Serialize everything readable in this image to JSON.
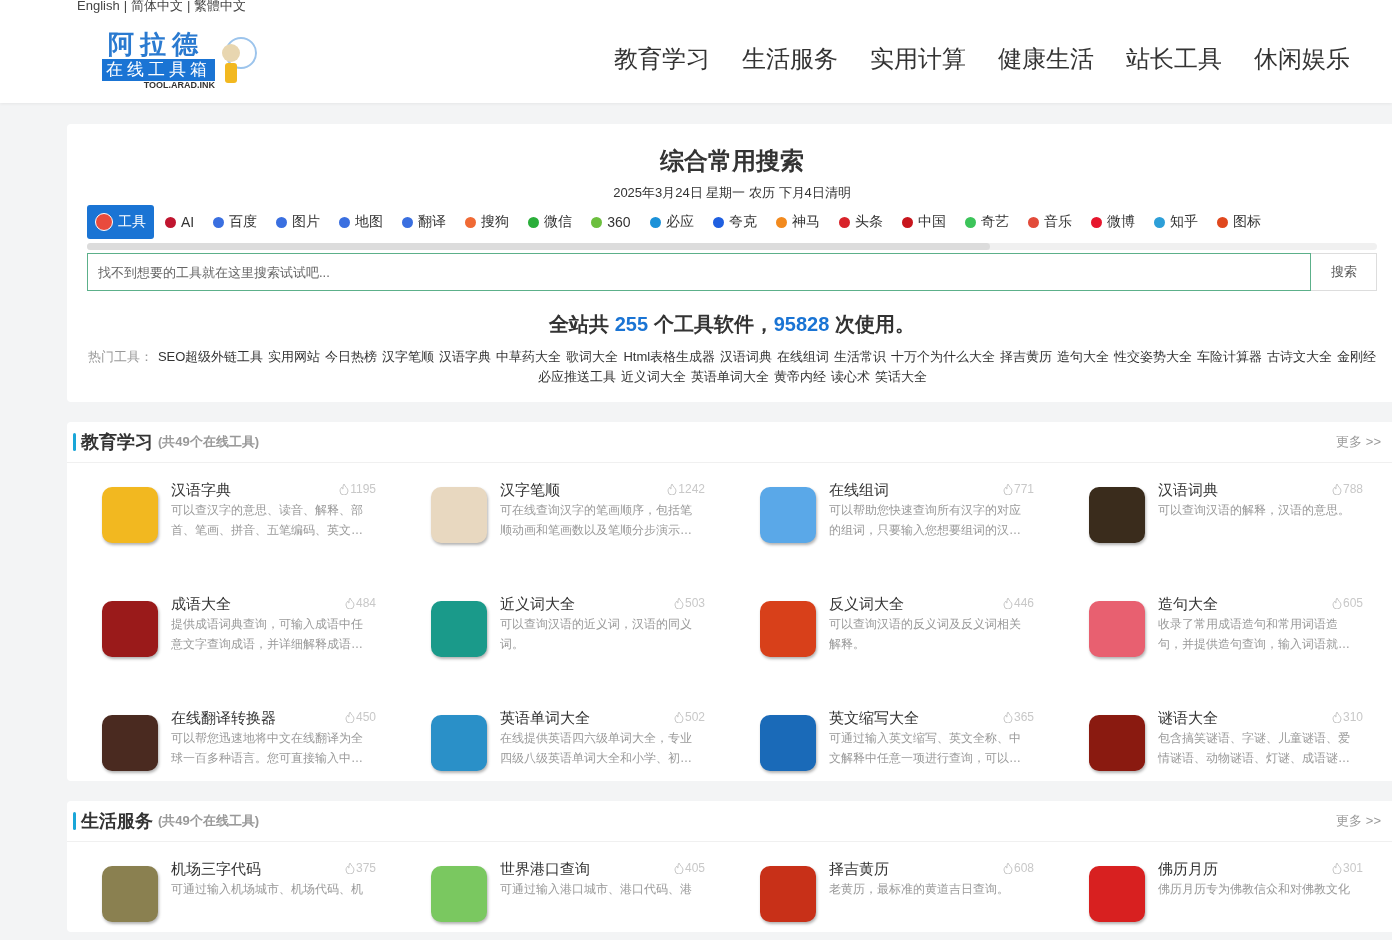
{
  "languages": [
    "English",
    "简体中文",
    "繁體中文"
  ],
  "language_separator": "|",
  "logo": {
    "title": "阿拉德",
    "subtitle": "在线工具箱",
    "domain": "TOOL.ARAD.INK"
  },
  "nav": [
    "教育学习",
    "生活服务",
    "实用计算",
    "健康生活",
    "站长工具",
    "休闲娱乐"
  ],
  "search": {
    "title": "综合常用搜索",
    "date": "2025年3月24日 星期一 农历 下月4日清明",
    "engines": [
      {
        "label": "工具",
        "selected": true,
        "color": "#e94b3c"
      },
      {
        "label": "AI",
        "selected": false,
        "color": "#c0152f"
      },
      {
        "label": "百度",
        "selected": false,
        "color": "#3a6fe0"
      },
      {
        "label": "图片",
        "selected": false,
        "color": "#3a6fe0"
      },
      {
        "label": "地图",
        "selected": false,
        "color": "#3a6fe0"
      },
      {
        "label": "翻译",
        "selected": false,
        "color": "#3a6fe0"
      },
      {
        "label": "搜狗",
        "selected": false,
        "color": "#f06a35"
      },
      {
        "label": "微信",
        "selected": false,
        "color": "#2aae3a"
      },
      {
        "label": "360",
        "selected": false,
        "color": "#6cbf3e"
      },
      {
        "label": "必应",
        "selected": false,
        "color": "#1b91d8"
      },
      {
        "label": "夸克",
        "selected": false,
        "color": "#1f5fe0"
      },
      {
        "label": "神马",
        "selected": false,
        "color": "#f28a1e"
      },
      {
        "label": "头条",
        "selected": false,
        "color": "#d8232a"
      },
      {
        "label": "中国",
        "selected": false,
        "color": "#c8161d"
      },
      {
        "label": "奇艺",
        "selected": false,
        "color": "#3cc45a"
      },
      {
        "label": "音乐",
        "selected": false,
        "color": "#e24b3a"
      },
      {
        "label": "微博",
        "selected": false,
        "color": "#e6162d"
      },
      {
        "label": "知乎",
        "selected": false,
        "color": "#2d9fd8"
      },
      {
        "label": "图标",
        "selected": false,
        "color": "#e0481e"
      }
    ],
    "placeholder": "找不到想要的工具就在这里搜索试试吧...",
    "button": "搜索",
    "stats": "全站共 **255** 个工具软件，**95828** 次使用。",
    "hot_label": "热门工具：",
    "hot_links": [
      "SEO超级外链工具",
      "实用网站",
      "今日热榜",
      "汉字笔顺",
      "汉语字典",
      "中草药大全",
      "歌词大全",
      "Html表格生成器",
      "汉语词典",
      "在线组词",
      "生活常识",
      "十万个为什么大全",
      "择吉黄历",
      "造句大全",
      "性交姿势大全",
      "车险计算器",
      "古诗文大全",
      "金刚经",
      "必应推送工具",
      "近义词大全",
      "英语单词大全",
      "黄帝内经",
      "读心术",
      "笑话大全"
    ]
  },
  "sections": [
    {
      "title": "教育学习",
      "count": "(共49个在线工具)",
      "more": "更多 >>",
      "tools": [
        {
          "name": "汉语字典",
          "views": "1195",
          "desc": "可以查汉字的意思、读音、解释、部首、笔画、拼音、五笔编码、英文…",
          "color": "#f2b820"
        },
        {
          "name": "汉字笔顺",
          "views": "1242",
          "desc": "可在线查询汉字的笔画顺序，包括笔顺动画和笔画数以及笔顺分步演示…",
          "color": "#e8d8c0"
        },
        {
          "name": "在线组词",
          "views": "771",
          "desc": "可以帮助您快速查询所有汉字的对应的组词，只要输入您想要组词的汉…",
          "color": "#5aa8e8"
        },
        {
          "name": "汉语词典",
          "views": "788",
          "desc": "可以查询汉语的解释，汉语的意思。",
          "color": "#3a2c1c"
        },
        {
          "name": "成语大全",
          "views": "484",
          "desc": "提供成语词典查询，可输入成语中任意文字查询成语，并详细解释成语…",
          "color": "#9a1a1a"
        },
        {
          "name": "近义词大全",
          "views": "503",
          "desc": "可以查询汉语的近义词，汉语的同义词。",
          "color": "#1a9a8a"
        },
        {
          "name": "反义词大全",
          "views": "446",
          "desc": "可以查询汉语的反义词及反义词相关解释。",
          "color": "#d8401a"
        },
        {
          "name": "造句大全",
          "views": "605",
          "desc": "收录了常用成语造句和常用词语造句，并提供造句查询，输入词语就…",
          "color": "#e86070"
        },
        {
          "name": "在线翻译转换器",
          "views": "450",
          "desc": "可以帮您迅速地将中文在线翻译为全球一百多种语言。您可直接输入中…",
          "color": "#4a2a20"
        },
        {
          "name": "英语单词大全",
          "views": "502",
          "desc": "在线提供英语四六级单词大全，专业四级八级英语单词大全和小学、初…",
          "color": "#2a90c8"
        },
        {
          "name": "英文缩写大全",
          "views": "365",
          "desc": "可通过输入英文缩写、英文全称、中文解释中任意一项进行查询，可以…",
          "color": "#1a6ab8"
        },
        {
          "name": "谜语大全",
          "views": "310",
          "desc": "包含搞笑谜语、字谜、儿童谜语、爱情谜语、动物谜语、灯谜、成语谜…",
          "color": "#8a1a10"
        }
      ]
    },
    {
      "title": "生活服务",
      "count": "(共49个在线工具)",
      "more": "更多 >>",
      "tools": [
        {
          "name": "机场三字代码",
          "views": "375",
          "desc": "可通过输入机场城市、机场代码、机",
          "color": "#8a8050"
        },
        {
          "name": "世界港口查询",
          "views": "405",
          "desc": "可通过输入港口城市、港口代码、港",
          "color": "#7ac860"
        },
        {
          "name": "择吉黄历",
          "views": "608",
          "desc": "老黄历，最标准的黄道吉日查询。",
          "color": "#c83018"
        },
        {
          "name": "佛历月历",
          "views": "301",
          "desc": "佛历月历专为佛教信众和对佛教文化",
          "color": "#d82020"
        }
      ]
    }
  ]
}
